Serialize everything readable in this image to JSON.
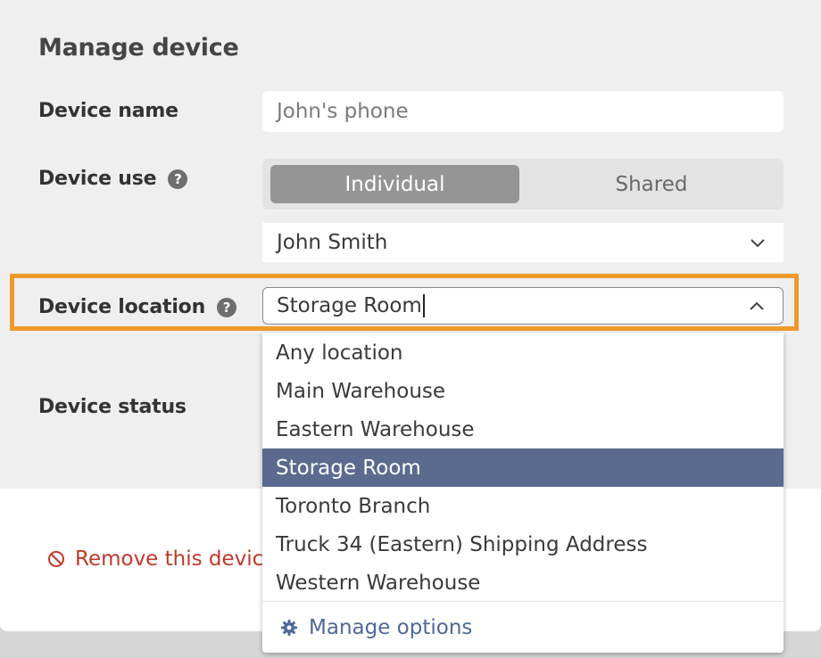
{
  "form": {
    "title": "Manage device",
    "device_name": {
      "label": "Device name",
      "value": "John's phone"
    },
    "device_use": {
      "label": "Device use",
      "help_icon": "question-circle-icon",
      "help_glyph": "?",
      "options": [
        "Individual",
        "Shared"
      ],
      "selected": "Individual",
      "assignee": "John Smith"
    },
    "device_location": {
      "label": "Device location",
      "help_icon": "question-circle-icon",
      "help_glyph": "?",
      "value": "Storage Room",
      "dropdown": {
        "options": [
          "Any location",
          "Main Warehouse",
          "Eastern Warehouse",
          "Storage Room",
          "Toronto Branch",
          "Truck 34 (Eastern) Shipping Address",
          "Western Warehouse"
        ],
        "selected": "Storage Room",
        "manage_label": "Manage options",
        "manage_icon": "gear-icon"
      }
    },
    "device_status": {
      "label": "Device status"
    },
    "remove_label": "Remove this device",
    "remove_icon": "prohibited-icon"
  },
  "colors": {
    "highlight": "#ee9a2d",
    "selected_option": "#5a6b8f",
    "danger": "#c0392b",
    "link": "#4f6896",
    "segment_active": "#959595"
  }
}
